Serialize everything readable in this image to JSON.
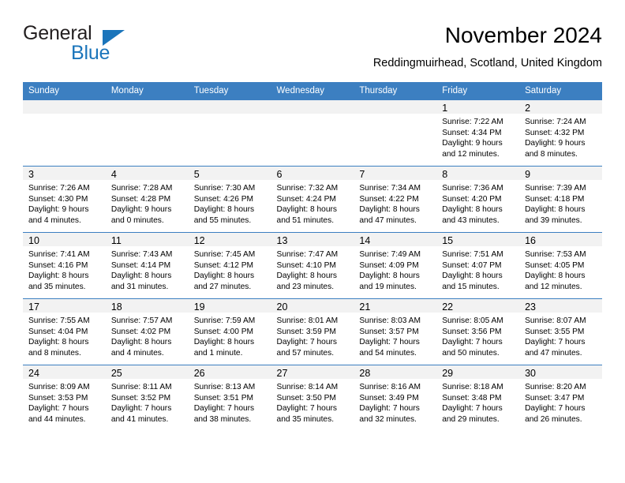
{
  "brand": {
    "word1": "General",
    "word2": "Blue",
    "triangle_color": "#1b75bb"
  },
  "header": {
    "title": "November 2024",
    "location": "Reddingmuirhead, Scotland, United Kingdom"
  },
  "theme": {
    "header_bg": "#3c7fc1",
    "daynum_band_bg": "#f2f2f2",
    "grid_line": "#3c7fc1",
    "text": "#000000"
  },
  "weekdays": [
    "Sunday",
    "Monday",
    "Tuesday",
    "Wednesday",
    "Thursday",
    "Friday",
    "Saturday"
  ],
  "weeks": [
    [
      {
        "day": "",
        "lines": []
      },
      {
        "day": "",
        "lines": []
      },
      {
        "day": "",
        "lines": []
      },
      {
        "day": "",
        "lines": []
      },
      {
        "day": "",
        "lines": []
      },
      {
        "day": "1",
        "lines": [
          "Sunrise: 7:22 AM",
          "Sunset: 4:34 PM",
          "Daylight: 9 hours",
          "and 12 minutes."
        ]
      },
      {
        "day": "2",
        "lines": [
          "Sunrise: 7:24 AM",
          "Sunset: 4:32 PM",
          "Daylight: 9 hours",
          "and 8 minutes."
        ]
      }
    ],
    [
      {
        "day": "3",
        "lines": [
          "Sunrise: 7:26 AM",
          "Sunset: 4:30 PM",
          "Daylight: 9 hours",
          "and 4 minutes."
        ]
      },
      {
        "day": "4",
        "lines": [
          "Sunrise: 7:28 AM",
          "Sunset: 4:28 PM",
          "Daylight: 9 hours",
          "and 0 minutes."
        ]
      },
      {
        "day": "5",
        "lines": [
          "Sunrise: 7:30 AM",
          "Sunset: 4:26 PM",
          "Daylight: 8 hours",
          "and 55 minutes."
        ]
      },
      {
        "day": "6",
        "lines": [
          "Sunrise: 7:32 AM",
          "Sunset: 4:24 PM",
          "Daylight: 8 hours",
          "and 51 minutes."
        ]
      },
      {
        "day": "7",
        "lines": [
          "Sunrise: 7:34 AM",
          "Sunset: 4:22 PM",
          "Daylight: 8 hours",
          "and 47 minutes."
        ]
      },
      {
        "day": "8",
        "lines": [
          "Sunrise: 7:36 AM",
          "Sunset: 4:20 PM",
          "Daylight: 8 hours",
          "and 43 minutes."
        ]
      },
      {
        "day": "9",
        "lines": [
          "Sunrise: 7:39 AM",
          "Sunset: 4:18 PM",
          "Daylight: 8 hours",
          "and 39 minutes."
        ]
      }
    ],
    [
      {
        "day": "10",
        "lines": [
          "Sunrise: 7:41 AM",
          "Sunset: 4:16 PM",
          "Daylight: 8 hours",
          "and 35 minutes."
        ]
      },
      {
        "day": "11",
        "lines": [
          "Sunrise: 7:43 AM",
          "Sunset: 4:14 PM",
          "Daylight: 8 hours",
          "and 31 minutes."
        ]
      },
      {
        "day": "12",
        "lines": [
          "Sunrise: 7:45 AM",
          "Sunset: 4:12 PM",
          "Daylight: 8 hours",
          "and 27 minutes."
        ]
      },
      {
        "day": "13",
        "lines": [
          "Sunrise: 7:47 AM",
          "Sunset: 4:10 PM",
          "Daylight: 8 hours",
          "and 23 minutes."
        ]
      },
      {
        "day": "14",
        "lines": [
          "Sunrise: 7:49 AM",
          "Sunset: 4:09 PM",
          "Daylight: 8 hours",
          "and 19 minutes."
        ]
      },
      {
        "day": "15",
        "lines": [
          "Sunrise: 7:51 AM",
          "Sunset: 4:07 PM",
          "Daylight: 8 hours",
          "and 15 minutes."
        ]
      },
      {
        "day": "16",
        "lines": [
          "Sunrise: 7:53 AM",
          "Sunset: 4:05 PM",
          "Daylight: 8 hours",
          "and 12 minutes."
        ]
      }
    ],
    [
      {
        "day": "17",
        "lines": [
          "Sunrise: 7:55 AM",
          "Sunset: 4:04 PM",
          "Daylight: 8 hours",
          "and 8 minutes."
        ]
      },
      {
        "day": "18",
        "lines": [
          "Sunrise: 7:57 AM",
          "Sunset: 4:02 PM",
          "Daylight: 8 hours",
          "and 4 minutes."
        ]
      },
      {
        "day": "19",
        "lines": [
          "Sunrise: 7:59 AM",
          "Sunset: 4:00 PM",
          "Daylight: 8 hours",
          "and 1 minute."
        ]
      },
      {
        "day": "20",
        "lines": [
          "Sunrise: 8:01 AM",
          "Sunset: 3:59 PM",
          "Daylight: 7 hours",
          "and 57 minutes."
        ]
      },
      {
        "day": "21",
        "lines": [
          "Sunrise: 8:03 AM",
          "Sunset: 3:57 PM",
          "Daylight: 7 hours",
          "and 54 minutes."
        ]
      },
      {
        "day": "22",
        "lines": [
          "Sunrise: 8:05 AM",
          "Sunset: 3:56 PM",
          "Daylight: 7 hours",
          "and 50 minutes."
        ]
      },
      {
        "day": "23",
        "lines": [
          "Sunrise: 8:07 AM",
          "Sunset: 3:55 PM",
          "Daylight: 7 hours",
          "and 47 minutes."
        ]
      }
    ],
    [
      {
        "day": "24",
        "lines": [
          "Sunrise: 8:09 AM",
          "Sunset: 3:53 PM",
          "Daylight: 7 hours",
          "and 44 minutes."
        ]
      },
      {
        "day": "25",
        "lines": [
          "Sunrise: 8:11 AM",
          "Sunset: 3:52 PM",
          "Daylight: 7 hours",
          "and 41 minutes."
        ]
      },
      {
        "day": "26",
        "lines": [
          "Sunrise: 8:13 AM",
          "Sunset: 3:51 PM",
          "Daylight: 7 hours",
          "and 38 minutes."
        ]
      },
      {
        "day": "27",
        "lines": [
          "Sunrise: 8:14 AM",
          "Sunset: 3:50 PM",
          "Daylight: 7 hours",
          "and 35 minutes."
        ]
      },
      {
        "day": "28",
        "lines": [
          "Sunrise: 8:16 AM",
          "Sunset: 3:49 PM",
          "Daylight: 7 hours",
          "and 32 minutes."
        ]
      },
      {
        "day": "29",
        "lines": [
          "Sunrise: 8:18 AM",
          "Sunset: 3:48 PM",
          "Daylight: 7 hours",
          "and 29 minutes."
        ]
      },
      {
        "day": "30",
        "lines": [
          "Sunrise: 8:20 AM",
          "Sunset: 3:47 PM",
          "Daylight: 7 hours",
          "and 26 minutes."
        ]
      }
    ]
  ]
}
